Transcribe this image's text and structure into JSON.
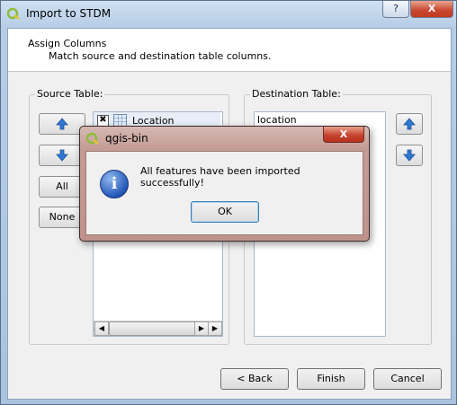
{
  "window": {
    "title": "Import to STDM",
    "help_label": "?",
    "close_label": "X"
  },
  "header": {
    "title": "Assign Columns",
    "subtitle": "Match source and destination table columns."
  },
  "source": {
    "label": "Source Table:",
    "all_label": "All",
    "none_label": "None",
    "items": [
      {
        "label": "Location",
        "checked": true
      }
    ]
  },
  "destination": {
    "label": "Destination Table:",
    "items": [
      "location"
    ]
  },
  "buttons": {
    "back": "< Back",
    "finish": "Finish",
    "cancel": "Cancel"
  },
  "message_box": {
    "title": "qgis-bin",
    "close_label": "X",
    "icon": "information-icon",
    "icon_glyph": "i",
    "text": "All features have been imported successfully!",
    "ok_label": "OK"
  },
  "icons": {
    "app_icon": "qgis-icon",
    "move_up": "arrow-up-icon",
    "move_down": "arrow-down-icon",
    "table": "table-grid-icon"
  },
  "colors": {
    "arrow_blue": "#2f78d4",
    "close_red": "#c43b22",
    "qgis_green": "#8bbd3b"
  }
}
